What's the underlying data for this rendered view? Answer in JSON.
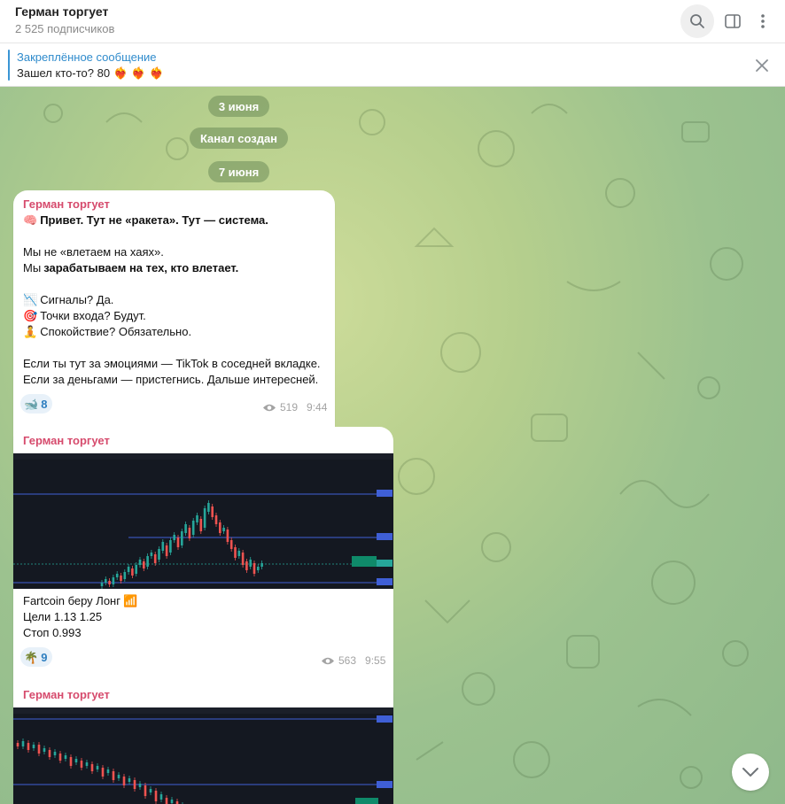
{
  "header": {
    "title": "Герман торгует",
    "subscribers": "2 525 подписчиков"
  },
  "pinned": {
    "title": "Закреплённое сообщение",
    "text": "Зашел кто-то?  80"
  },
  "dates": {
    "d1": "3 июня",
    "created": "Канал создан",
    "d2": "7 июня"
  },
  "msg1": {
    "author": "Герман торгует",
    "line1": "Привет. Тут не «ракета». Тут — система.",
    "line2": "Мы не «влетаем на хаях».",
    "line3a": "Мы ",
    "line3b": "зарабатываем на тех, кто влетает.",
    "line4": "Сигналы? Да.",
    "line5": "Точки входа? Будут.",
    "line6": " Спокойствие? Обязательно.",
    "line7": "Если ты тут за эмоциями — TikTok в соседней вкладке.",
    "line8": "Если за деньгами — пристегнись. Дальше интересней.",
    "reaction_count": "8",
    "views": "519",
    "time": "9:44"
  },
  "msg2": {
    "author": "Герман торгует",
    "line1": "Fartcoin беру Лонг",
    "line2": "Цели 1.13 1.25",
    "line3": "Стоп 0.993",
    "reaction_count": "9",
    "views": "563",
    "time": "9:55"
  },
  "msg3": {
    "author": "Герман торгует"
  },
  "colors": {
    "accent": "#2f8bcc",
    "author": "#d64b6d",
    "chart_bg": "#141821",
    "candle_up": "#26a69a",
    "candle_down": "#ef5350"
  }
}
